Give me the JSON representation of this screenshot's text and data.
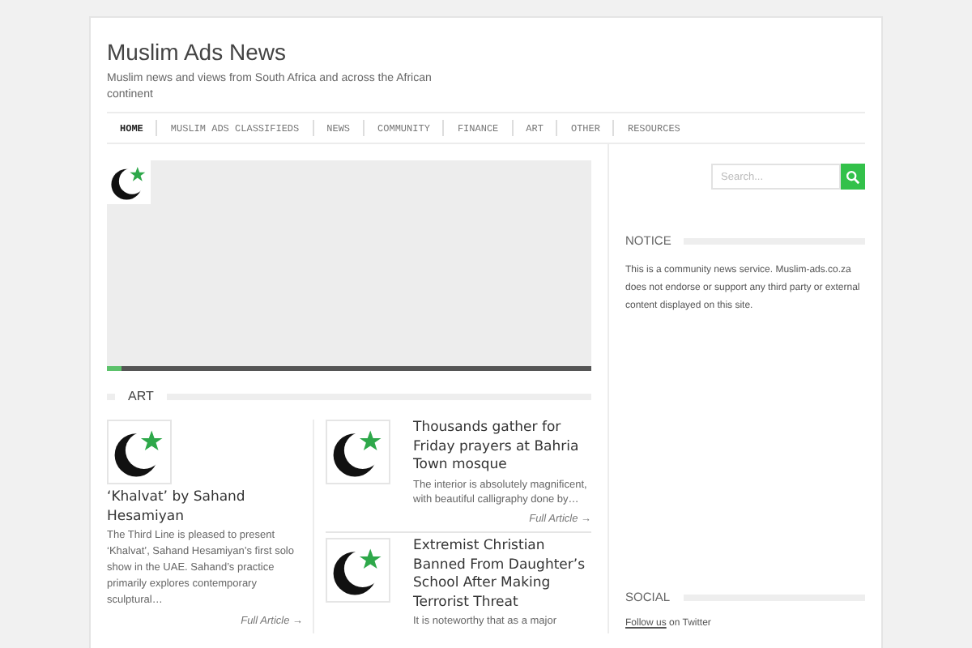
{
  "site": {
    "title": "Muslim Ads News",
    "tagline": "Muslim news and views from South Africa and across the African continent"
  },
  "nav": [
    {
      "label": "HOME",
      "selected": true
    },
    {
      "label": "MUSLIM ADS CLASSIFIEDS",
      "selected": false
    },
    {
      "label": "NEWS",
      "selected": false
    },
    {
      "label": "COMMUNITY",
      "selected": false
    },
    {
      "label": "FINANCE",
      "selected": false
    },
    {
      "label": "ART",
      "selected": false
    },
    {
      "label": "OTHER",
      "selected": false
    },
    {
      "label": "RESOURCES",
      "selected": false
    }
  ],
  "slider": {
    "level": 0.03
  },
  "section": {
    "title": "ART"
  },
  "featured": {
    "title": "‘Khalvat’ by Sahand Hesamiyan",
    "excerpt": "The Third Line is pleased to present ‘Khalvat’, Sahand Hesamiyan’s first solo show in the UAE. Sahand’s practice primarily explores contemporary sculptural…",
    "more": "Full Article →"
  },
  "articles": [
    {
      "title": "Thousands gather for Friday prayers at Bahria Town mosque",
      "excerpt": "The interior is absolutely magnificent, with beautiful calligraphy done by…",
      "more": "Full Article →"
    },
    {
      "title": "Extremist Christian Banned From Daughter’s School After Making Terrorist Threat",
      "excerpt": "It is noteworthy that as a major"
    }
  ],
  "sidebar": {
    "search": {
      "placeholder": "Search..."
    },
    "notice": {
      "title": "NOTICE",
      "text": "This is a community news service. Muslim-ads.co.za does not endorse or support any third party or external content displayed on this site."
    },
    "social": {
      "title": "SOCIAL",
      "link": "Follow us",
      "text": "on Twitter"
    }
  }
}
